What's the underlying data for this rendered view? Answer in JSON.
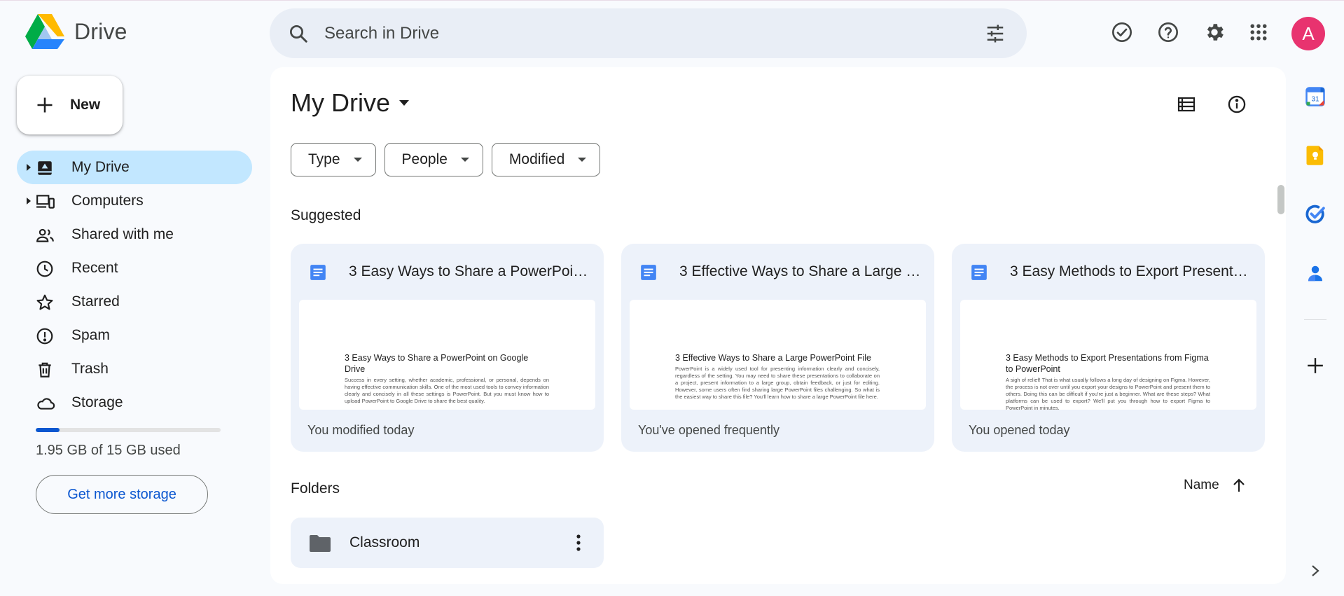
{
  "app": {
    "name": "Drive"
  },
  "header": {
    "search_placeholder": "Search in Drive",
    "avatar_initial": "A"
  },
  "sidebar": {
    "new_label": "New",
    "items": [
      {
        "label": "My Drive",
        "icon": "my-drive-icon",
        "active": true,
        "expandable": true
      },
      {
        "label": "Computers",
        "icon": "computers-icon",
        "active": false,
        "expandable": true
      },
      {
        "label": "Shared with me",
        "icon": "shared-icon",
        "active": false
      },
      {
        "label": "Recent",
        "icon": "clock-icon",
        "active": false
      },
      {
        "label": "Starred",
        "icon": "star-icon",
        "active": false
      },
      {
        "label": "Spam",
        "icon": "spam-icon",
        "active": false
      },
      {
        "label": "Trash",
        "icon": "trash-icon",
        "active": false
      },
      {
        "label": "Storage",
        "icon": "cloud-icon",
        "active": false
      }
    ],
    "storage": {
      "used_fraction": 0.13,
      "text": "1.95 GB of 15 GB used",
      "button_label": "Get more storage"
    }
  },
  "main": {
    "title": "My Drive",
    "filters": [
      "Type",
      "People",
      "Modified"
    ],
    "suggested_label": "Suggested",
    "suggested": [
      {
        "title": "3 Easy Ways to Share a PowerPoint on Google Drive",
        "preview_heading": "3 Easy Ways to Share a PowerPoint on Google Drive",
        "preview_text": "Success in every setting, whether academic, professional, or personal, depends on having effective communication skills. One of the most used tools to convey information clearly and concisely in all these settings is PowerPoint. But you must know how to upload PowerPoint to Google Drive to share the best quality.",
        "footer": "You modified today"
      },
      {
        "title": "3 Effective Ways to Share a Large PowerPoint File",
        "preview_heading": "3 Effective Ways to Share a Large PowerPoint File",
        "preview_text": "PowerPoint is a widely used tool for presenting information clearly and concisely, regardless of the setting. You may need to share these presentations to collaborate on a project, present information to a large group, obtain feedback, or just for editing. However, some users often find sharing large PowerPoint files challenging. So what is the easiest way to share this file? You'll learn how to share a large PowerPoint file here.",
        "footer": "You've opened frequently"
      },
      {
        "title": "3 Easy Methods to Export Presentations from Figma to PowerPoint",
        "preview_heading": "3 Easy Methods to Export Presentations from Figma to PowerPoint",
        "preview_text": "A sigh of relief! That is what usually follows a long day of designing on Figma. However, the process is not over until you export your designs to PowerPoint and present them to others. Doing this can be difficult if you're just a beginner. What are these steps? What platforms can be used to export? We'll put you through how to export Figma to PowerPoint in minutes.",
        "footer": "You opened today"
      }
    ],
    "folders_label": "Folders",
    "sort_label": "Name",
    "folders": [
      {
        "name": "Classroom"
      }
    ]
  },
  "colors": {
    "accent": "#0b57d0",
    "active_nav": "#c2e7ff",
    "avatar": "#e8336f",
    "doc_blue": "#4285f4"
  }
}
